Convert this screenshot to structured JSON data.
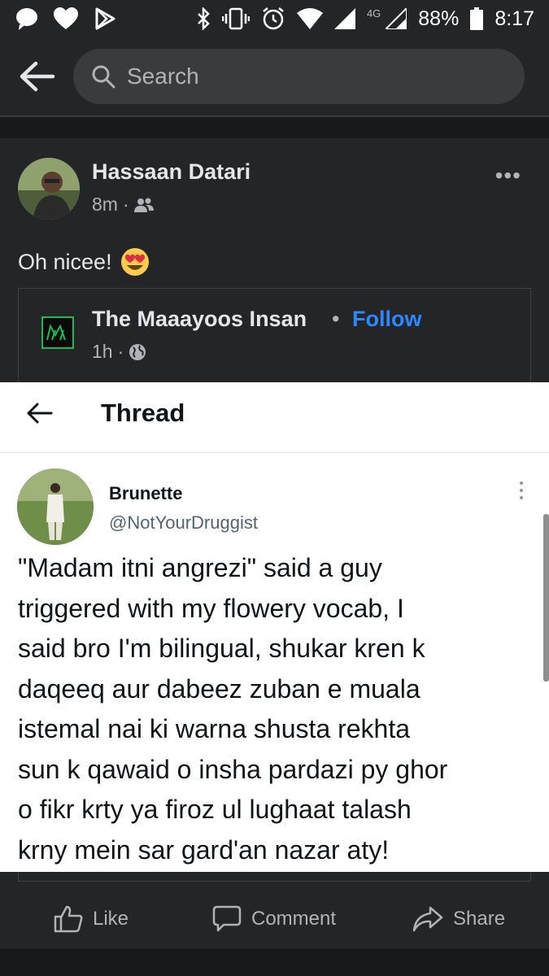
{
  "status_bar": {
    "network": "4G",
    "battery": "88%",
    "time": "8:17"
  },
  "header": {
    "search_placeholder": "Search"
  },
  "post": {
    "author": "Hassaan Datari",
    "time": "8m",
    "audience_icon": "friends-icon",
    "text": "Oh nicee!",
    "emoji": "😍",
    "shared": {
      "page_name": "The Maaayoos Insan",
      "separator": "•",
      "follow_label": "Follow",
      "time": "1h",
      "audience_icon": "globe-icon",
      "tweet": {
        "header_title": "Thread",
        "name": "Brunette",
        "handle": "@NotYourDruggist",
        "text": "\"Madam itni angrezi\" said a guy\ntriggered with my flowery vocab, I\nsaid bro I'm bilingual, shukar kren k\ndaqeeq aur dabeez zuban e muala\nistemal nai ki warna shusta rekhta\nsun k qawaid o insha pardazi py ghor\no fikr krty ya firoz ul lughaat talash\nkrny mein sar gard'an nazar aty!"
      }
    },
    "actions": {
      "like": "Like",
      "comment": "Comment",
      "share": "Share"
    }
  },
  "colors": {
    "background": "#18191a",
    "surface": "#242526",
    "link": "#2d88ff",
    "text_primary": "#e4e6eb",
    "text_secondary": "#b0b3b8"
  }
}
